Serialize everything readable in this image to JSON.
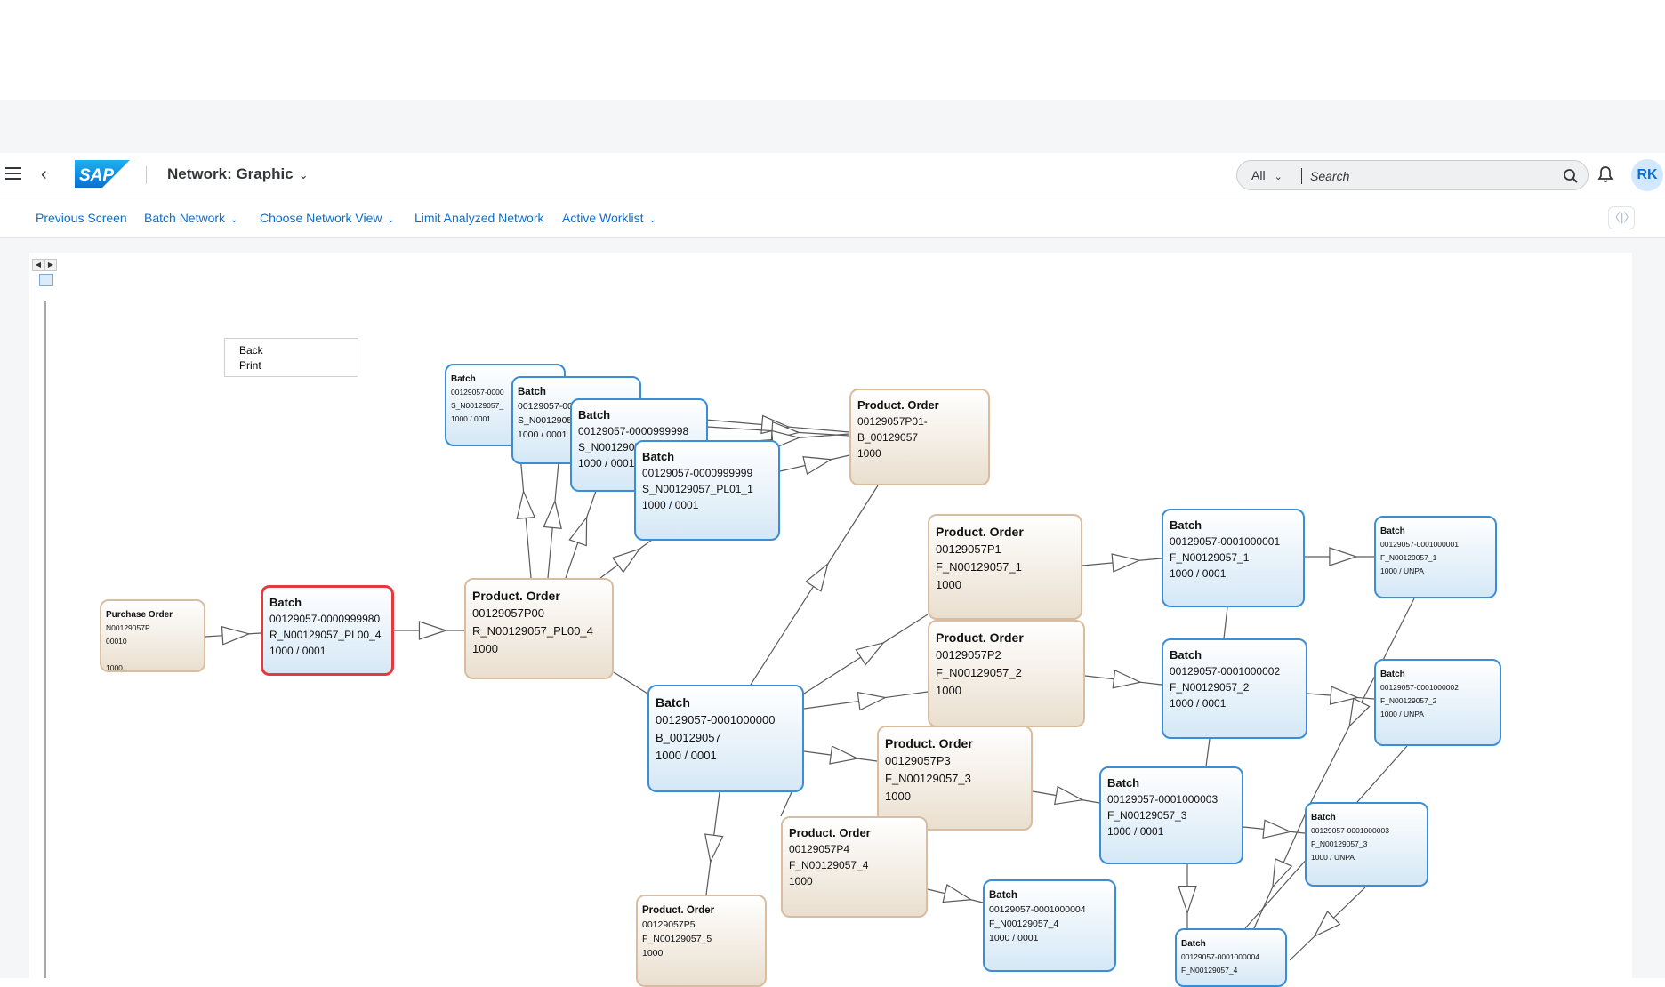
{
  "shell": {
    "app_title": "Network: Graphic",
    "search_scope": "All",
    "search_placeholder": "Search",
    "avatar_initials": "RK",
    "brand": "SAP"
  },
  "toolbar": {
    "previous_screen": "Previous Screen",
    "batch_network": "Batch Network",
    "choose_network_view": "Choose Network View",
    "limit_analyzed_network": "Limit Analyzed Network",
    "active_worklist": "Active Worklist"
  },
  "context_menu": {
    "back": "Back",
    "print": "Print"
  },
  "colors": {
    "link": "#0a6ed1",
    "batch_border": "#3b8ed6",
    "order_border": "#d9bda1",
    "selected_border": "#e33b3b"
  },
  "nodes": {
    "po": {
      "title": "Purchase Order",
      "l1": "N00129057P",
      "l2": "00010",
      "l3": "",
      "l4": "1000"
    },
    "b_sel": {
      "title": "Batch",
      "l1": "00129057-0000999980",
      "l2": "R_N00129057_PL00_4",
      "l3": "1000 / 0001"
    },
    "po_r": {
      "title": "Product. Order",
      "l1": "00129057P00-",
      "l2": "R_N00129057_PL00_4",
      "l3": "1000"
    },
    "b_s1": {
      "title": "Batch",
      "l1": "00129057-0000",
      "l2": "S_N00129057_",
      "l3": "1000 / 0001"
    },
    "b_s2": {
      "title": "Batch",
      "l1": "00129057-00",
      "l2": "S_N0012905",
      "l3": "1000 / 0001"
    },
    "b_s3": {
      "title": "Batch",
      "l1": "00129057-0000999998",
      "l2": "S_N0012905",
      "l3": "1000 / 0001"
    },
    "b_s4": {
      "title": "Batch",
      "l1": "00129057-0000999999",
      "l2": "S_N00129057_PL01_1",
      "l3": "1000 / 0001"
    },
    "po_b": {
      "title": "Product. Order",
      "l1": "00129057P01-",
      "l2": "B_00129057",
      "l3": "1000"
    },
    "b_main": {
      "title": "Batch",
      "l1": "00129057-0001000000",
      "l2": "B_00129057",
      "l3": "1000 / 0001"
    },
    "po_p1": {
      "title": "Product. Order",
      "l1": "00129057P1",
      "l2": "F_N00129057_1",
      "l3": "1000"
    },
    "po_p2": {
      "title": "Product. Order",
      "l1": "00129057P2",
      "l2": "F_N00129057_2",
      "l3": "1000"
    },
    "po_p3": {
      "title": "Product. Order",
      "l1": "00129057P3",
      "l2": "F_N00129057_3",
      "l3": "1000"
    },
    "po_p4": {
      "title": "Product. Order",
      "l1": "00129057P4",
      "l2": "F_N00129057_4",
      "l3": "1000"
    },
    "po_p5": {
      "title": "Product. Order",
      "l1": "00129057P5",
      "l2": "F_N00129057_5",
      "l3": "1000"
    },
    "b_f1": {
      "title": "Batch",
      "l1": "00129057-0001000001",
      "l2": "F_N00129057_1",
      "l3": "1000 / 0001"
    },
    "b_f2": {
      "title": "Batch",
      "l1": "00129057-0001000002",
      "l2": "F_N00129057_2",
      "l3": "1000 / 0001"
    },
    "b_f3": {
      "title": "Batch",
      "l1": "00129057-0001000003",
      "l2": "F_N00129057_3",
      "l3": "1000 / 0001"
    },
    "b_f4": {
      "title": "Batch",
      "l1": "00129057-0001000004",
      "l2": "F_N00129057_4",
      "l3": "1000 / 0001"
    },
    "b_u1": {
      "title": "Batch",
      "l1": "00129057-0001000001",
      "l2": "F_N00129057_1",
      "l3": "1000 / UNPA"
    },
    "b_u2": {
      "title": "Batch",
      "l1": "00129057-0001000002",
      "l2": "F_N00129057_2",
      "l3": "1000 / UNPA"
    },
    "b_u3": {
      "title": "Batch",
      "l1": "00129057-0001000003",
      "l2": "F_N00129057_3",
      "l3": "1000 / UNPA"
    },
    "b_u4": {
      "title": "Batch",
      "l1": "00129057-0001000004",
      "l2": "F_N00129057_4",
      "l3": ""
    }
  }
}
